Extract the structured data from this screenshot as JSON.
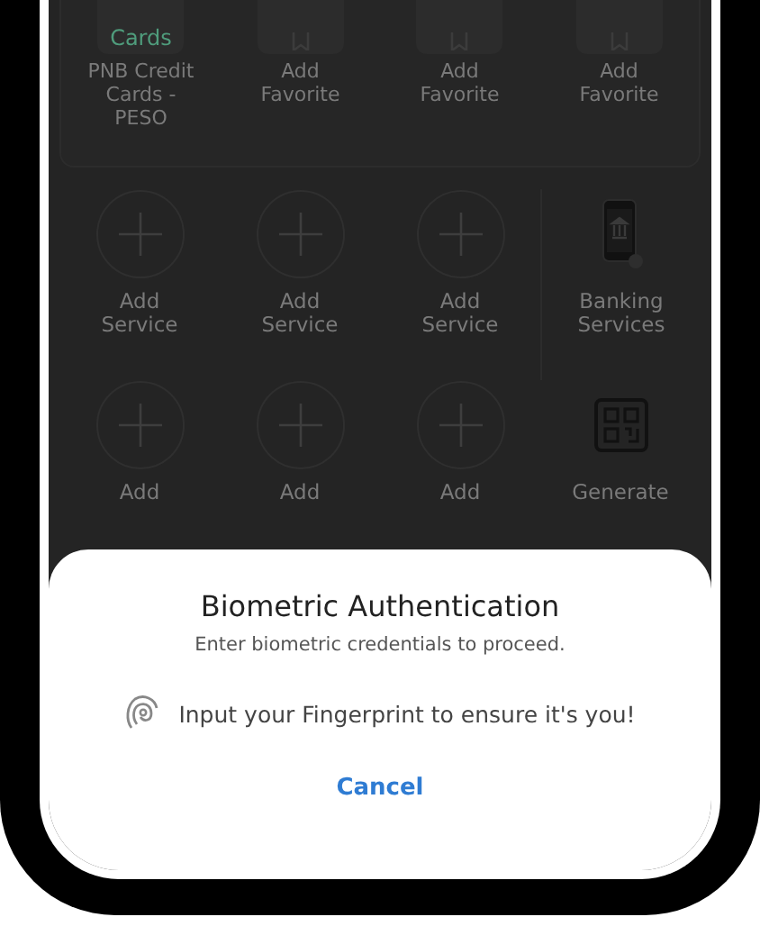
{
  "favorites": [
    {
      "kind": "card",
      "tile_text": "Cards",
      "label": "PNB Credit Cards - PESO"
    },
    {
      "kind": "add",
      "label": "Add Favorite"
    },
    {
      "kind": "add",
      "label": "Add Favorite"
    },
    {
      "kind": "add",
      "label": "Add Favorite"
    }
  ],
  "services": [
    {
      "kind": "add",
      "label": "Add Service"
    },
    {
      "kind": "add",
      "label": "Add Service"
    },
    {
      "kind": "add",
      "label": "Add Service"
    },
    {
      "kind": "banking",
      "label": "Banking Services"
    },
    {
      "kind": "add",
      "label": "Add"
    },
    {
      "kind": "add",
      "label": "Add"
    },
    {
      "kind": "add",
      "label": "Add"
    },
    {
      "kind": "qr",
      "label": "Generate"
    }
  ],
  "dialog": {
    "title": "Biometric Authentication",
    "subtitle": "Enter biometric credentials to proceed.",
    "prompt": "Input your Fingerprint to ensure it's you!",
    "cancel": "Cancel"
  }
}
